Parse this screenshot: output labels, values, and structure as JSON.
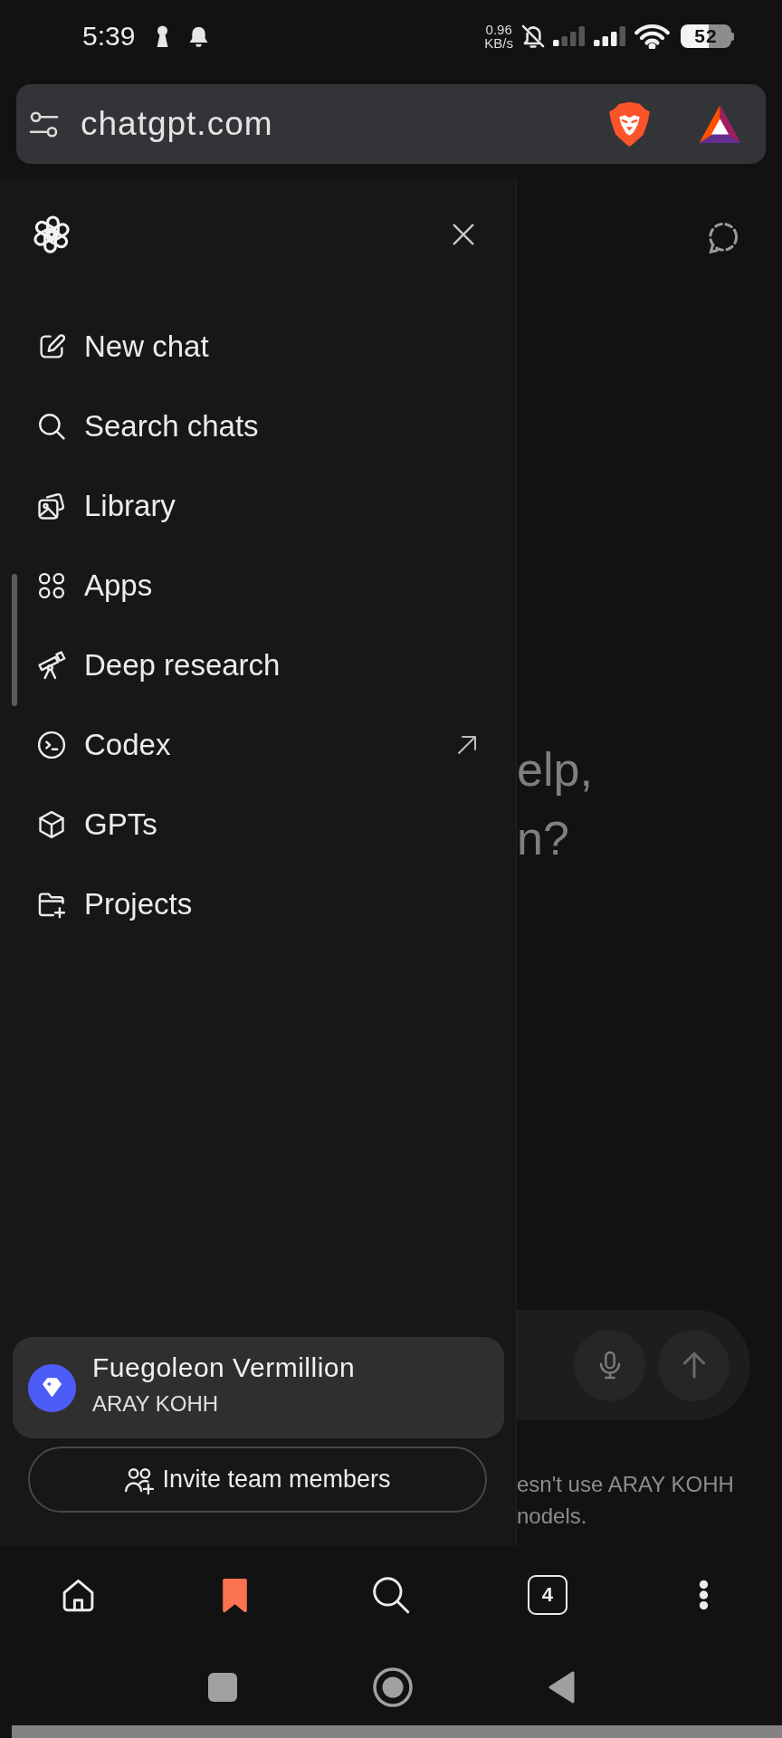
{
  "status_bar": {
    "time": "5:39",
    "speed": "0.96",
    "speed_unit": "KB/s",
    "battery": "52"
  },
  "address_bar": {
    "url": "chatgpt.com"
  },
  "sidebar": {
    "items": [
      {
        "label": "New chat",
        "external": false
      },
      {
        "label": "Search chats",
        "external": false
      },
      {
        "label": "Library",
        "external": false
      },
      {
        "label": "Apps",
        "external": false
      },
      {
        "label": "Deep research",
        "external": false
      },
      {
        "label": "Codex",
        "external": true
      },
      {
        "label": "GPTs",
        "external": false
      },
      {
        "label": "Projects",
        "external": false
      }
    ],
    "account": {
      "name": "Fuegoleon Vermillion",
      "workspace": "ARAY KOHH"
    },
    "invite_button": "Invite team members"
  },
  "main_page": {
    "heading_lines": [
      "elp,",
      "n?"
    ],
    "disclaimer_lines": [
      "esn't use ARAY KOHH",
      "nodels."
    ]
  },
  "bottom_nav": {
    "items": [
      {
        "kind": "home",
        "selected": false
      },
      {
        "kind": "bookmarks",
        "selected": true
      },
      {
        "kind": "search",
        "selected": false
      },
      {
        "kind": "tabs",
        "count": "4",
        "selected": false
      },
      {
        "kind": "menu",
        "selected": false
      }
    ]
  }
}
